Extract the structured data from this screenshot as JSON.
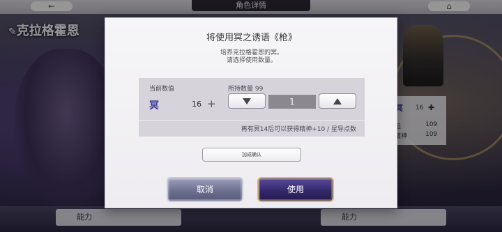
{
  "background": {
    "header_title": "角色详情",
    "character_name": "克拉格霍恩",
    "right_panel": {
      "icon_char": "冥",
      "level": "16",
      "rows": [
        {
          "label": "运",
          "value": "109"
        },
        {
          "label": "精神",
          "value": "109"
        }
      ]
    },
    "bottom_tabs": [
      "能力",
      "能力"
    ]
  },
  "dialog": {
    "title": "将使用冥之诱语《枪》",
    "description_line1": "培养克拉格霍恩的冥。",
    "description_line2": "请选择使用数量。",
    "current_label": "当前数值",
    "owned_label": "所持数量 99",
    "stat_icon_char": "冥",
    "current_value": "16",
    "plus_sign": "+",
    "quantity": "1",
    "note": "再有冥14后可以获得精神+10 / 星导点数",
    "confirm_small_label": "加成确认",
    "cancel_label": "取消",
    "use_label": "使用"
  },
  "colors": {
    "accent_gold": "#d6b878",
    "use_button": "#34286b",
    "cancel_button": "#6d7090"
  }
}
